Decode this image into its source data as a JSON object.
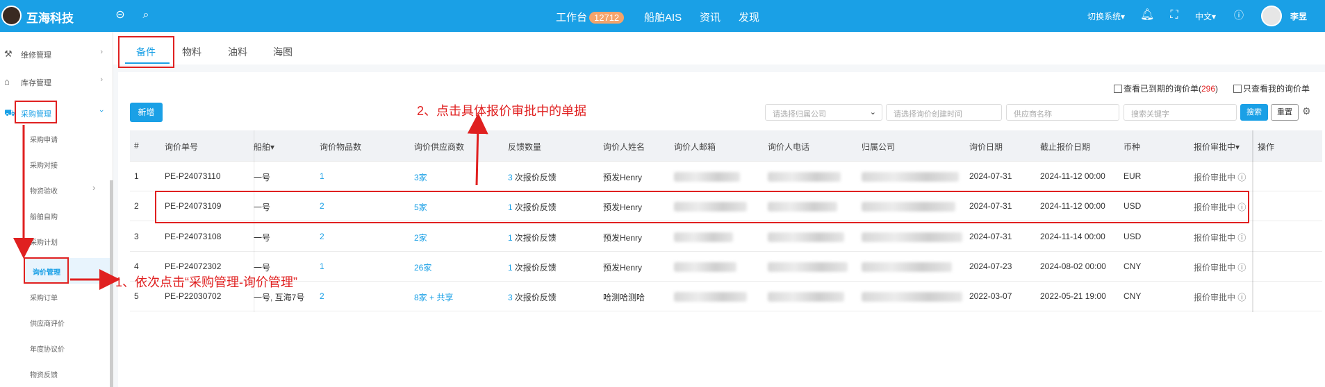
{
  "header": {
    "brand": "互海科技",
    "nav": [
      {
        "label": "工作台",
        "badge": "12712"
      },
      {
        "label": "船舶AIS"
      },
      {
        "label": "资讯"
      },
      {
        "label": "发现"
      }
    ],
    "switch_system": "切换系统▾",
    "language": "中文▾",
    "user": "李昱",
    "icons": [
      "back-circle-icon",
      "search-icon",
      "bell-icon",
      "fullscreen-icon",
      "help-icon"
    ]
  },
  "sidebar": {
    "groups": [
      {
        "label": "维修管理",
        "icon": "wrench-icon"
      },
      {
        "label": "库存管理",
        "icon": "home-icon"
      },
      {
        "label": "采购管理",
        "icon": "cart-icon"
      }
    ],
    "sub_items": [
      "采购申请",
      "采购对接",
      "物资验收",
      "船舶自购",
      "采购计划",
      "询价管理",
      "采购订单",
      "供应商评价",
      "年度协议价",
      "物资反馈"
    ],
    "active": "询价管理"
  },
  "tabs": [
    "备件",
    "物料",
    "油料",
    "海图"
  ],
  "toolbar": {
    "check_expired": "查看已到期的询价单(",
    "expired_count": "296",
    "check_expired_end": ")",
    "check_mine": "只查看我的询价单",
    "new_button": "新增",
    "company_placeholder": "请选择归属公司",
    "date_placeholder": "请选择询价创建时间",
    "supplier_placeholder": "供应商名称",
    "keyword_placeholder": "搜索关键字",
    "search_button": "搜索",
    "reset_button": "重置"
  },
  "table": {
    "headers": [
      "#",
      "询价单号",
      "船舶▾",
      "询价物品数",
      "询价供应商数",
      "反馈数量",
      "询价人姓名",
      "询价人邮箱",
      "询价人电话",
      "归属公司",
      "询价日期",
      "截止报价日期",
      "币种",
      "报价审批中▾",
      "操作"
    ],
    "rows": [
      {
        "no": "1",
        "id": "PE-P24073110",
        "ship": "一号",
        "items": "1",
        "suppliers": "3家",
        "feedback_n": "3",
        "feedback_t": "次报价反馈",
        "name": "预发Henry",
        "date": "2024-07-31",
        "deadline": "2024-11-12 00:00",
        "currency": "EUR",
        "status": "报价审批中"
      },
      {
        "no": "2",
        "id": "PE-P24073109",
        "ship": "一号",
        "items": "2",
        "suppliers": "5家",
        "feedback_n": "1",
        "feedback_t": "次报价反馈",
        "name": "预发Henry",
        "date": "2024-07-31",
        "deadline": "2024-11-12 00:00",
        "currency": "USD",
        "status": "报价审批中"
      },
      {
        "no": "3",
        "id": "PE-P24073108",
        "ship": "一号",
        "items": "2",
        "suppliers": "2家",
        "feedback_n": "1",
        "feedback_t": "次报价反馈",
        "name": "预发Henry",
        "date": "2024-07-31",
        "deadline": "2024-11-14 00:00",
        "currency": "USD",
        "status": "报价审批中"
      },
      {
        "no": "4",
        "id": "PE-P24072302",
        "ship": "一号",
        "items": "1",
        "suppliers": "26家",
        "feedback_n": "1",
        "feedback_t": "次报价反馈",
        "name": "预发Henry",
        "date": "2024-07-23",
        "deadline": "2024-08-02 00:00",
        "currency": "CNY",
        "status": "报价审批中"
      },
      {
        "no": "5",
        "id": "PE-P22030702",
        "ship": "一号, 互海7号",
        "items": "2",
        "suppliers": "8家 + 共享",
        "feedback_n": "3",
        "feedback_t": "次报价反馈",
        "name": "哈测哈测哈",
        "date": "2022-03-07",
        "deadline": "2022-05-21 19:00",
        "currency": "CNY",
        "status": "报价审批中"
      }
    ]
  },
  "annotations": {
    "step1": "1、依次点击“采购管理-询价管理”",
    "step2": "2、点击具体报价审批中的单据"
  }
}
